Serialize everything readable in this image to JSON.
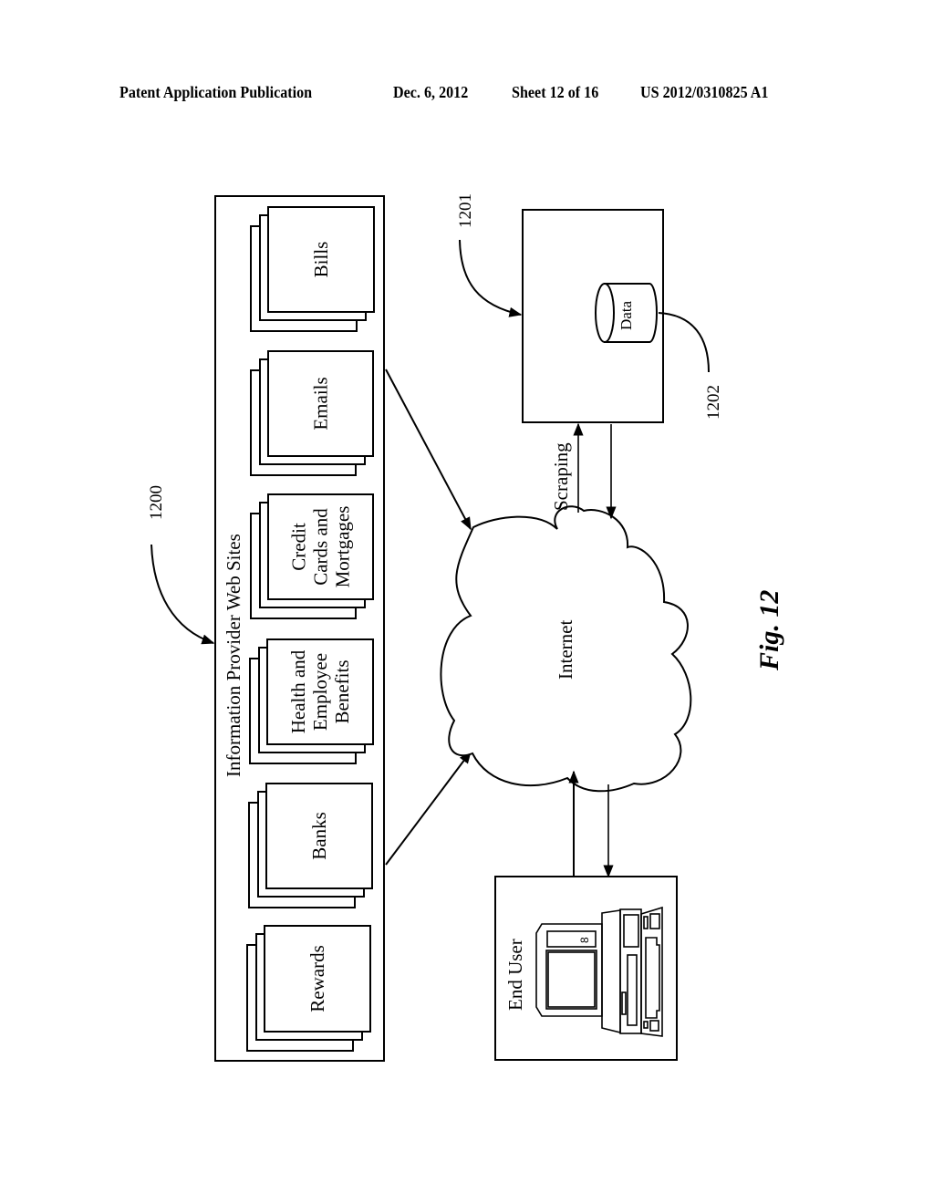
{
  "header": {
    "publication": "Patent Application Publication",
    "date": "Dec. 6, 2012",
    "sheet": "Sheet 12 of 16",
    "number": "US 2012/0310825 A1"
  },
  "figure": {
    "caption": "Fig. 12",
    "refs": {
      "system": "1200",
      "server": "1201",
      "database": "1202"
    },
    "provider_group": {
      "title": "Information Provider Web Sites",
      "sites": [
        {
          "lines": [
            "Bills"
          ]
        },
        {
          "lines": [
            "Emails"
          ]
        },
        {
          "lines": [
            "Credit",
            "Cards and",
            "Mortgages"
          ]
        },
        {
          "lines": [
            "Health and",
            "Employee",
            "Benefits"
          ]
        },
        {
          "lines": [
            "Banks"
          ]
        },
        {
          "lines": [
            "Rewards"
          ]
        }
      ]
    },
    "network": {
      "label": "Internet"
    },
    "database": {
      "label": "Data"
    },
    "connection": {
      "label": "Scraping"
    },
    "end_user": {
      "label": "End User",
      "icon": "computer-icon"
    }
  }
}
